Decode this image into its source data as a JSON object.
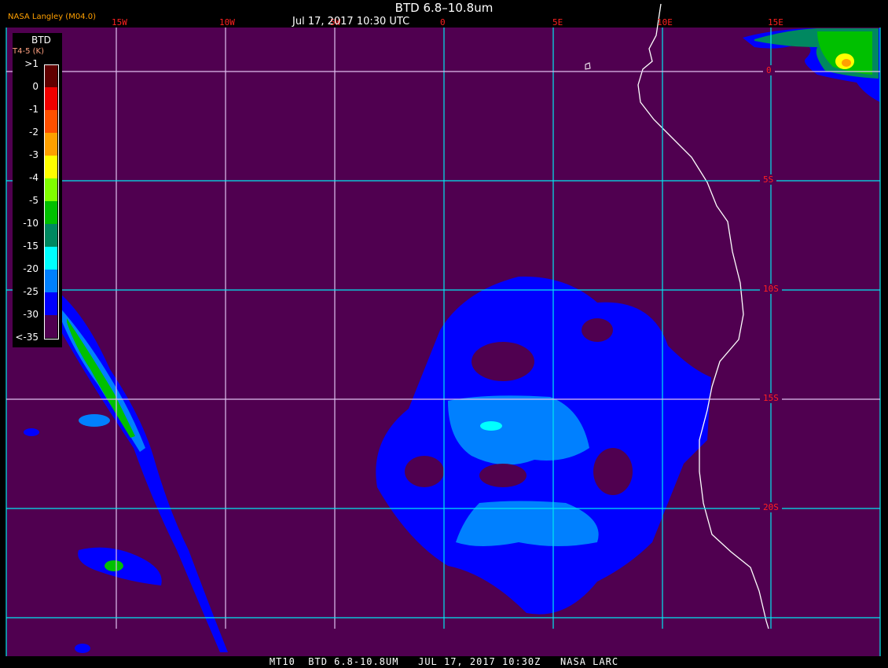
{
  "header": {
    "title": "BTD 6.8–10.8um",
    "date": "Jul 17, 2017 10:30 UTC",
    "credit": "NASA Langley (M04.0)"
  },
  "grid": {
    "lon_labels": [
      "15W",
      "10W",
      "5W",
      "0",
      "5E",
      "10E",
      "15E"
    ],
    "lat_labels": [
      "0",
      "5S",
      "10S",
      "15S",
      "20S"
    ]
  },
  "legend": {
    "title": "BTD",
    "subtitle": "T4-5 (K)",
    "labels": [
      ">1",
      "0",
      "-1",
      "-2",
      "-3",
      "-4",
      "-5",
      "-10",
      "-15",
      "-20",
      "-25",
      "-30",
      "<-35"
    ],
    "colors": [
      "#600000",
      "#f00000",
      "#ff5000",
      "#ffa000",
      "#ffff00",
      "#80ff00",
      "#00c000",
      "#008860",
      "#00ffff",
      "#0080ff",
      "#0000ff",
      "#500050"
    ]
  },
  "footer": "MT10  BTD 6.8-10.8UM   JUL 17, 2017 10:30Z   NASA LARC",
  "colors": {
    "background": "#500050",
    "grid_cyan": "#00e8f0",
    "grid_light": "#e0c0f0",
    "coastline": "#ffffff",
    "label_red": "#ff2020"
  }
}
